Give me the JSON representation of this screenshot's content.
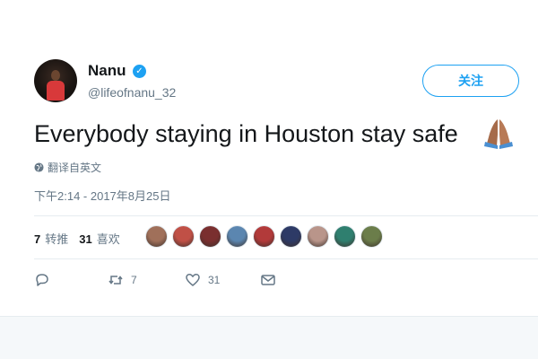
{
  "user": {
    "name": "Nanu",
    "handle": "@lifeofnanu_32",
    "verified": true
  },
  "follow_button": {
    "label": "关注"
  },
  "tweet": {
    "text": "Everybody staying in Houston stay safe",
    "emoji": "folded-hands",
    "translate_label": "翻译自英文",
    "timestamp": "下午2:14 - 2017年8月25日"
  },
  "stats": {
    "retweets_count": "7",
    "retweets_label": "转推",
    "likes_count": "31",
    "likes_label": "喜欢"
  },
  "liker_avatars": [
    {
      "color": "#a0705a"
    },
    {
      "color": "#c05046"
    },
    {
      "color": "#7a2f2f"
    },
    {
      "color": "#5b86b0"
    },
    {
      "color": "#b23a3a"
    },
    {
      "color": "#2d3a66"
    },
    {
      "color": "#b9958a"
    },
    {
      "color": "#2f7f6f"
    },
    {
      "color": "#6b7d4a"
    }
  ],
  "actions": {
    "reply_count": "",
    "retweet_count": "7",
    "like_count": "31"
  },
  "colors": {
    "accent": "#1da1f2",
    "text": "#14171a",
    "muted": "#657786"
  }
}
